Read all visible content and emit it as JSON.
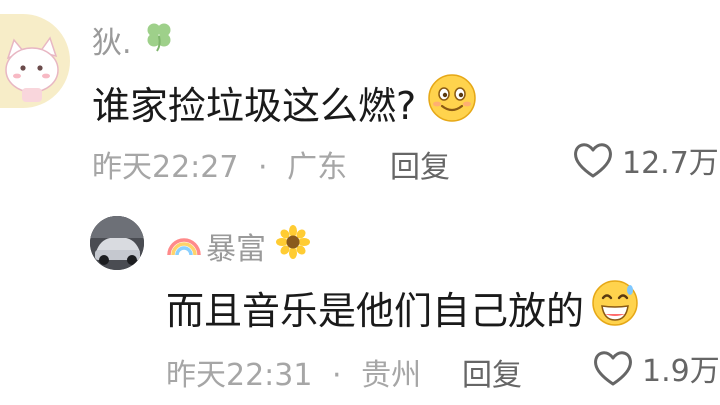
{
  "comments": [
    {
      "user": "狄.",
      "text": "谁家捡垃圾这么燃?",
      "time": "昨天22:27",
      "separator": "·",
      "location": "广东",
      "reply_label": "回复",
      "likes": "12.7万"
    },
    {
      "user": "暴富",
      "text": "而且音乐是他们自己放的",
      "time": "昨天22:31",
      "separator": "·",
      "location": "贵州",
      "reply_label": "回复",
      "likes": "1.9万"
    }
  ],
  "icons": {
    "clover": "four-leaf-clover-icon",
    "rainbow": "rainbow-icon",
    "sunflower": "sunflower-icon",
    "heart": "heart-outline-icon",
    "emoji_1": "smiling-face-emoji-icon",
    "emoji_2": "grinning-sweat-emoji-icon"
  },
  "colors": {
    "username": "#9a9a9a",
    "meta": "#a6a6a6",
    "action": "#666666",
    "text": "#1a1a1a"
  }
}
